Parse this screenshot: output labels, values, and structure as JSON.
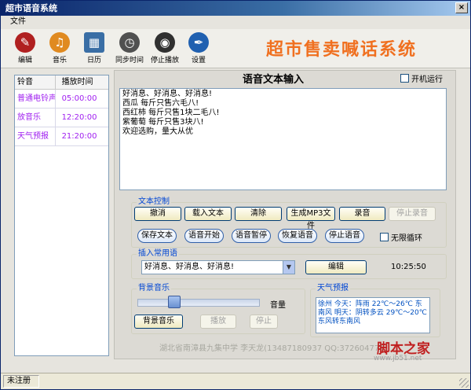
{
  "window": {
    "title": "超市语音系统",
    "close": "×"
  },
  "menu": {
    "file": "文件"
  },
  "toolbar": {
    "items": [
      {
        "label": "编辑",
        "icon": "edit-icon",
        "color": "#b02020"
      },
      {
        "label": "音乐",
        "icon": "music-icon",
        "color": "#e08a20"
      },
      {
        "label": "日历",
        "icon": "calendar-icon",
        "color": "#3a6ea5"
      },
      {
        "label": "同步时间",
        "icon": "clock-icon",
        "color": "#505050"
      },
      {
        "label": "停止播放",
        "icon": "stop-icon",
        "color": "#303030"
      },
      {
        "label": "设置",
        "icon": "pen-icon",
        "color": "#2060b0"
      }
    ],
    "app_title": "超市售卖喊话系统"
  },
  "schedule": {
    "headers": [
      "铃音",
      "播放时间"
    ],
    "rows": [
      {
        "name": "普通电铃声",
        "time": "05:00:00"
      },
      {
        "name": "放音乐",
        "time": "12:20:00"
      },
      {
        "name": "天气预报",
        "time": "21:20:00"
      }
    ]
  },
  "text_input": {
    "title": "语音文本输入",
    "autostart_label": "开机运行",
    "content": "好消息、好消息、好消息!\n西瓜 每斤只售六毛八!\n西红柿 每斤只售1块二毛八!\n紫葡萄 每斤只售3块八!\n欢迎选购，量大从优"
  },
  "text_control": {
    "label": "文本控制",
    "row1": [
      "撤消",
      "载入文本",
      "清除",
      "生成MP3文件",
      "录音",
      "停止录音"
    ],
    "row2": [
      "保存文本",
      "语音开始",
      "语音暂停",
      "恢复语音",
      "停止语音"
    ],
    "loop_label": "无限循环"
  },
  "phrases": {
    "label": "插入常用语",
    "selected": "好消息、好消息、好消息!",
    "edit_button": "编辑",
    "time": "10:25:50"
  },
  "bgm": {
    "label": "背景音乐",
    "volume_label": "音量",
    "volume": 0.28,
    "buttons": [
      "背景音乐",
      "播放",
      "停止"
    ]
  },
  "weather": {
    "label": "天气预报",
    "text": "徐州 今天：阵雨 22℃～26℃ 东南风 明天：阴转多云 29℃～20℃ 东风转东南风"
  },
  "footer": {
    "author": "湖北省南漳县九集中学 李天龙(13487180937 QQ:372604771)",
    "logo": "脚本之家",
    "logo_url": "www.jb51.net"
  },
  "status": {
    "text": "未注册"
  }
}
